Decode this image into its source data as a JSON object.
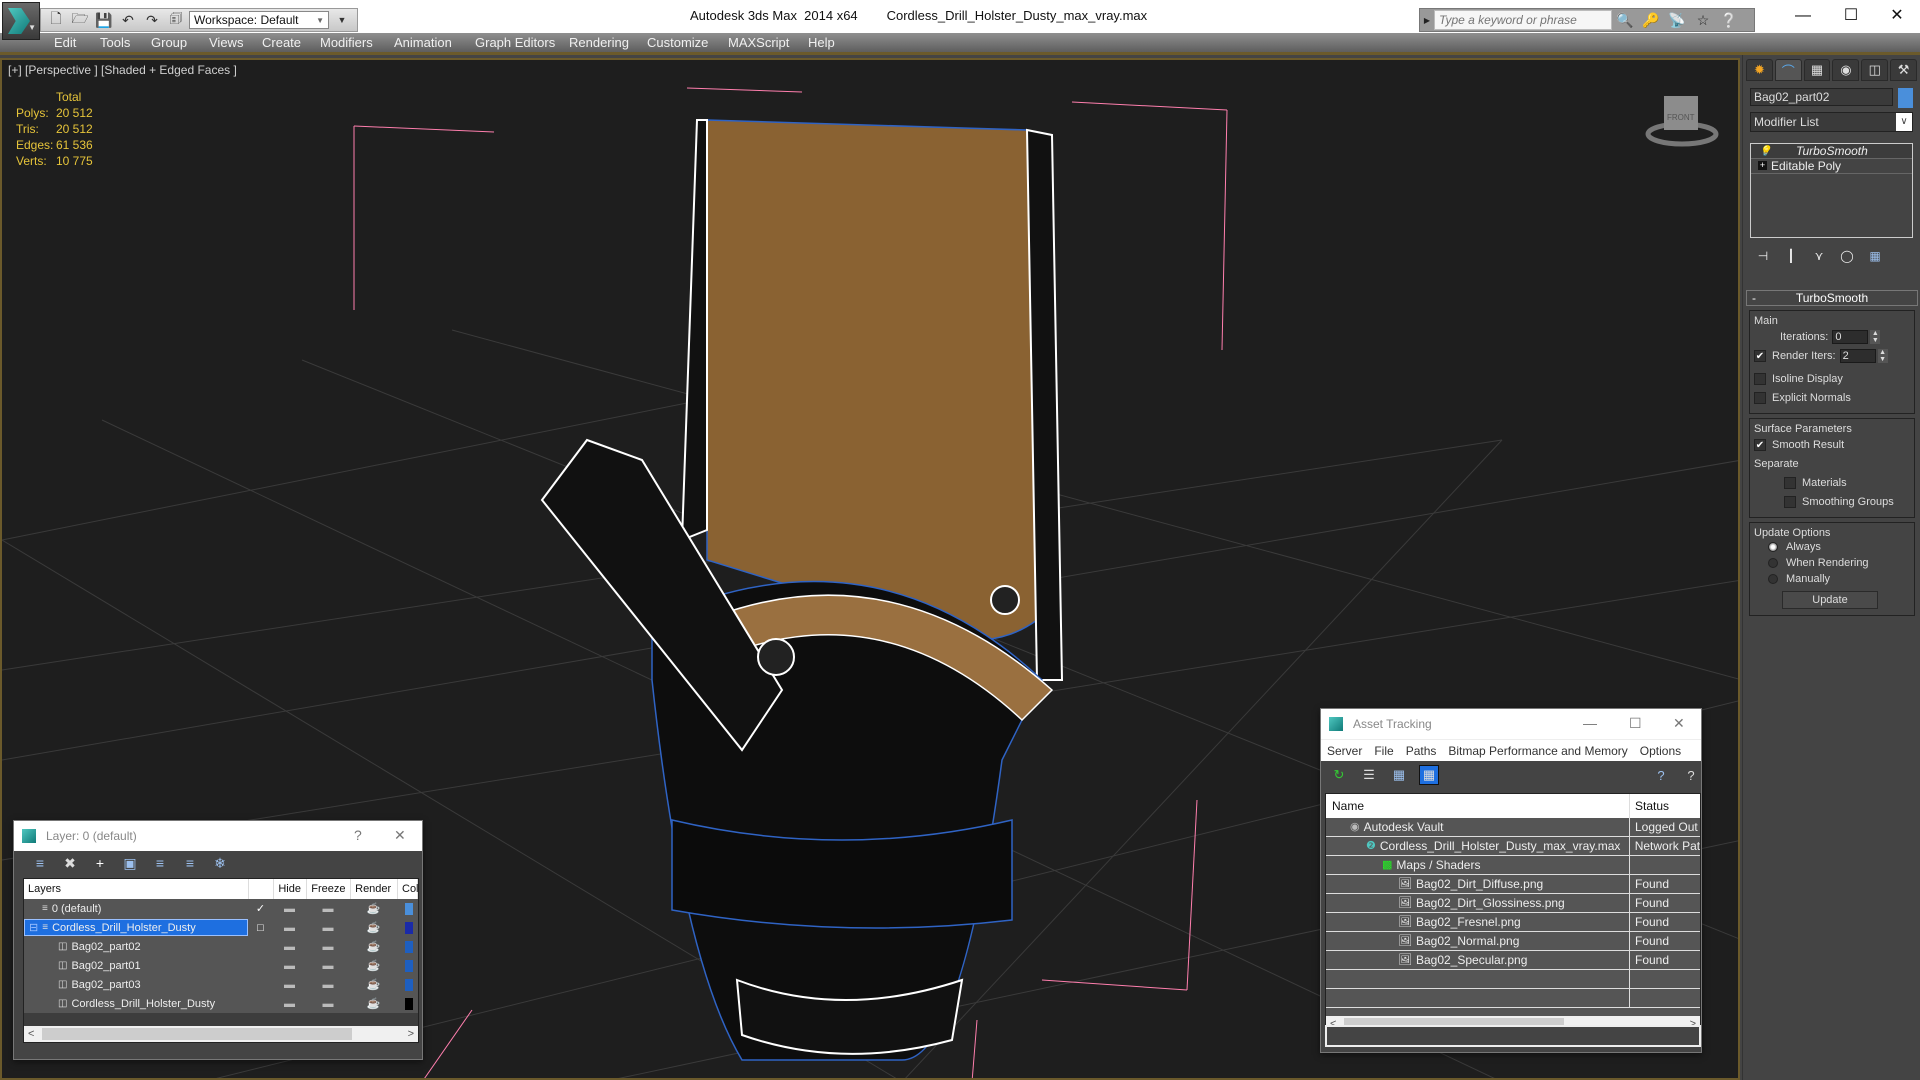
{
  "app": {
    "title": "Autodesk 3ds Max  2014 x64",
    "file": "Cordless_Drill_Holster_Dusty_max_vray.max",
    "workspace": "Workspace: Default",
    "search_placeholder": "Type a keyword or phrase"
  },
  "menu": [
    "Edit",
    "Tools",
    "Group",
    "Views",
    "Create",
    "Modifiers",
    "Animation",
    "Graph Editors",
    "Rendering",
    "Customize",
    "MAXScript",
    "Help"
  ],
  "viewport": {
    "label": "[+] [Perspective ] [Shaded + Edged Faces ]",
    "stats_header": "Total",
    "stats": [
      {
        "k": "Polys:",
        "v": "20 512"
      },
      {
        "k": "Tris:",
        "v": "20 512"
      },
      {
        "k": "Edges:",
        "v": "61 536"
      },
      {
        "k": "Verts:",
        "v": "10 775"
      }
    ],
    "viewcube_face": "FRONT"
  },
  "command_panel": {
    "object_name": "Bag02_part02",
    "object_color": "#4a8fdb",
    "modifier_list": "Modifier List",
    "stack": [
      "TurboSmooth",
      "Editable Poly"
    ],
    "rollout_title": "TurboSmooth",
    "main_label": "Main",
    "iterations_label": "Iterations:",
    "iterations": "0",
    "render_iters_label": "Render Iters:",
    "render_iters": "2",
    "render_iters_checked": true,
    "isoline_label": "Isoline Display",
    "explicit_normals_label": "Explicit Normals",
    "surface_label": "Surface Parameters",
    "smooth_result_label": "Smooth Result",
    "separate_label": "Separate",
    "materials_label": "Materials",
    "smoothing_groups_label": "Smoothing Groups",
    "update_options_label": "Update Options",
    "update_options": [
      "Always",
      "When Rendering",
      "Manually"
    ],
    "update_selected": "Always",
    "update_button": "Update"
  },
  "layer_dialog": {
    "title": "Layer: 0 (default)",
    "help": "?",
    "columns": [
      "Layers",
      "",
      "Hide",
      "Freeze",
      "Render",
      "Col"
    ],
    "rows": [
      {
        "name": "0 (default)",
        "active": true,
        "color": "#4a8fdb",
        "selected": false
      },
      {
        "name": "Cordless_Drill_Holster_Dusty",
        "active": false,
        "color": "#1a2aa8",
        "selected": true
      },
      {
        "name": "Bag02_part02",
        "color": "#1e5fc0"
      },
      {
        "name": "Bag02_part01",
        "color": "#1e5fc0"
      },
      {
        "name": "Bag02_part03",
        "color": "#1e5fc0"
      },
      {
        "name": "Cordless_Drill_Holster_Dusty",
        "color": "#000000"
      }
    ]
  },
  "asset_dialog": {
    "title": "Asset Tracking",
    "menu": [
      "Server",
      "File",
      "Paths",
      "Bitmap Performance and Memory",
      "Options"
    ],
    "columns": [
      "Name",
      "Status"
    ],
    "rows": [
      {
        "name": "Autodesk Vault",
        "status": "Logged Out",
        "indent": 1,
        "icon": "vault-icon"
      },
      {
        "name": "Cordless_Drill_Holster_Dusty_max_vray.max",
        "status": "Network Pat",
        "indent": 2,
        "icon": "max-file-icon"
      },
      {
        "name": "Maps / Shaders",
        "status": "",
        "indent": 3,
        "icon": "maps-icon"
      },
      {
        "name": "Bag02_Dirt_Diffuse.png",
        "status": "Found",
        "indent": 4,
        "icon": "bitmap-icon"
      },
      {
        "name": "Bag02_Dirt_Glossiness.png",
        "status": "Found",
        "indent": 4,
        "icon": "bitmap-icon"
      },
      {
        "name": "Bag02_Fresnel.png",
        "status": "Found",
        "indent": 4,
        "icon": "bitmap-icon"
      },
      {
        "name": "Bag02_Normal.png",
        "status": "Found",
        "indent": 4,
        "icon": "bitmap-icon"
      },
      {
        "name": "Bag02_Specular.png",
        "status": "Found",
        "indent": 4,
        "icon": "bitmap-icon"
      }
    ]
  }
}
